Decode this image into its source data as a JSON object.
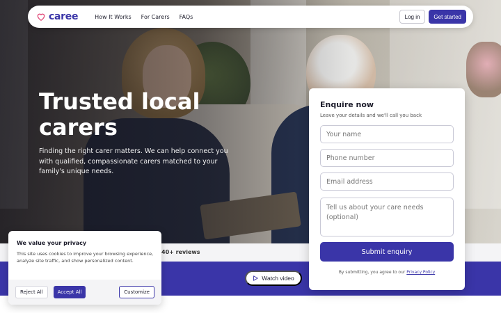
{
  "brand": {
    "name": "caree",
    "accent": "#3a35a8",
    "logo_icon": "heart-icon"
  },
  "nav": {
    "links": [
      "How It Works",
      "For Carers",
      "FAQs"
    ],
    "login_label": "Log in",
    "cta_label": "Get started"
  },
  "hero": {
    "title": "Trusted local carers",
    "description": "Finding the right carer matters. We can help connect you with qualified, compassionate carers matched to your family's unique needs."
  },
  "reviews": {
    "text": "40+ reviews"
  },
  "video": {
    "label": "Watch video",
    "icon": "play-icon"
  },
  "form": {
    "title": "Enquire now",
    "subtitle": "Leave your details and we'll call you back",
    "name_placeholder": "Your name",
    "phone_placeholder": "Phone number",
    "email_placeholder": "Email address",
    "needs_placeholder": "Tell us about your care needs (optional)",
    "submit_label": "Submit enquiry",
    "note_prefix": "By submitting, you agree to our",
    "note_link": "Privacy Policy"
  },
  "cookie": {
    "title": "We value your privacy",
    "text": "This site uses cookies to improve your browsing experience, analyze site traffic, and show personalized content.",
    "reject_label": "Reject All",
    "accept_label": "Accept All",
    "customize_label": "Customize"
  }
}
